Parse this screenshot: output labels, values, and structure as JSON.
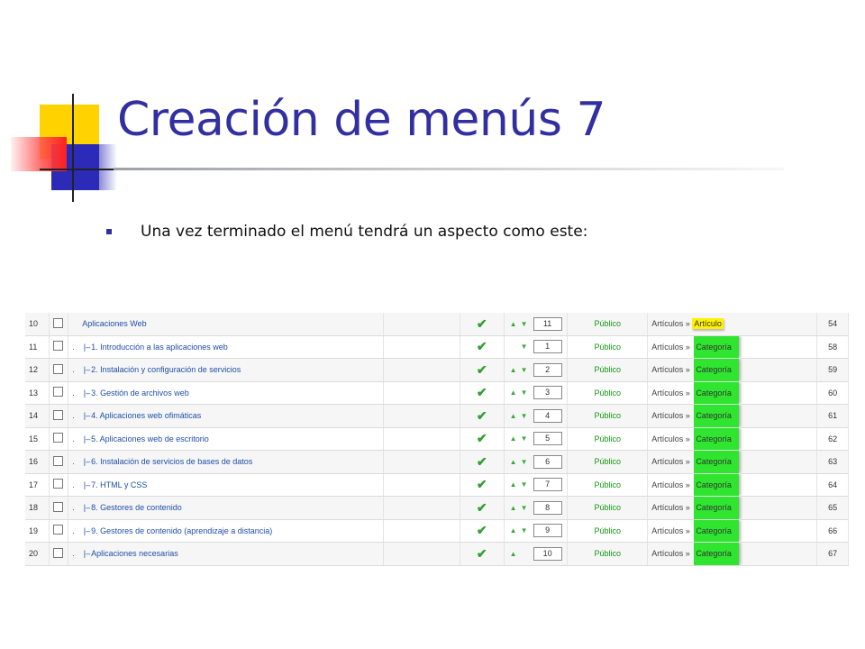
{
  "slide": {
    "title": "Creación de menús 7",
    "bullet": "Una vez terminado el menú tendrá un aspecto como este:"
  },
  "colors": {
    "title": "#3230a0",
    "link": "#1f4fa8",
    "access_green": "#119911",
    "highlight_yellow": "#fff200",
    "highlight_green": "#2fe52f"
  },
  "icons": {
    "published": "green-checkmark-icon",
    "up": "green-up-arrow-icon",
    "down": "green-down-arrow-icon",
    "checkbox": "checkbox-icon"
  },
  "menu_table": {
    "rows": [
      {
        "id": "10",
        "indent": "",
        "tree": "",
        "name": "Aplicaciones Web",
        "show_up": true,
        "show_down": true,
        "order": "11",
        "access": "Público",
        "type_base": "Artículos » ",
        "type_sub": "Artículo",
        "highlight": "yellow",
        "item_id": "54"
      },
      {
        "id": "11",
        "indent": ".",
        "tree": "|–",
        "name": "1. Introducción a las aplicaciones web",
        "show_up": false,
        "show_down": true,
        "order": "1",
        "access": "Público",
        "type_base": "Artículos » ",
        "type_sub": "Categoría",
        "highlight": "green",
        "item_id": "58"
      },
      {
        "id": "12",
        "indent": ".",
        "tree": "|–",
        "name": "2. Instalación y configuración de servicios",
        "show_up": true,
        "show_down": true,
        "order": "2",
        "access": "Público",
        "type_base": "Artículos » ",
        "type_sub": "Categoría",
        "highlight": "green",
        "item_id": "59"
      },
      {
        "id": "13",
        "indent": ".",
        "tree": "|–",
        "name": "3. Gestión de archivos web",
        "show_up": true,
        "show_down": true,
        "order": "3",
        "access": "Público",
        "type_base": "Artículos » ",
        "type_sub": "Categoría",
        "highlight": "green",
        "item_id": "60"
      },
      {
        "id": "14",
        "indent": ".",
        "tree": "|–",
        "name": "4. Aplicaciones web ofimáticas",
        "show_up": true,
        "show_down": true,
        "order": "4",
        "access": "Público",
        "type_base": "Artículos » ",
        "type_sub": "Categoría",
        "highlight": "green",
        "item_id": "61"
      },
      {
        "id": "15",
        "indent": ".",
        "tree": "|–",
        "name": "5. Aplicaciones web de escritorio",
        "show_up": true,
        "show_down": true,
        "order": "5",
        "access": "Público",
        "type_base": "Artículos » ",
        "type_sub": "Categoría",
        "highlight": "green",
        "item_id": "62"
      },
      {
        "id": "16",
        "indent": ".",
        "tree": "|–",
        "name": "6. Instalación de servicios de bases de datos",
        "show_up": true,
        "show_down": true,
        "order": "6",
        "access": "Público",
        "type_base": "Artículos » ",
        "type_sub": "Categoría",
        "highlight": "green",
        "item_id": "63"
      },
      {
        "id": "17",
        "indent": ".",
        "tree": "|–",
        "name": "7. HTML y CSS",
        "show_up": true,
        "show_down": true,
        "order": "7",
        "access": "Público",
        "type_base": "Artículos » ",
        "type_sub": "Categoría",
        "highlight": "green",
        "item_id": "64"
      },
      {
        "id": "18",
        "indent": ".",
        "tree": "|–",
        "name": "8. Gestores de contenido",
        "show_up": true,
        "show_down": true,
        "order": "8",
        "access": "Público",
        "type_base": "Artículos » ",
        "type_sub": "Categoría",
        "highlight": "green",
        "item_id": "65"
      },
      {
        "id": "19",
        "indent": ".",
        "tree": "|–",
        "name": "9. Gestores de contenido (aprendizaje a distancia)",
        "show_up": true,
        "show_down": true,
        "order": "9",
        "access": "Público",
        "type_base": "Artículos » ",
        "type_sub": "Categoría",
        "highlight": "green",
        "item_id": "66"
      },
      {
        "id": "20",
        "indent": ".",
        "tree": "|–",
        "name": "Aplicaciones necesarias",
        "show_up": true,
        "show_down": false,
        "order": "10",
        "access": "Público",
        "type_base": "Artículos » ",
        "type_sub": "Categoría",
        "highlight": "green",
        "item_id": "67"
      }
    ]
  }
}
